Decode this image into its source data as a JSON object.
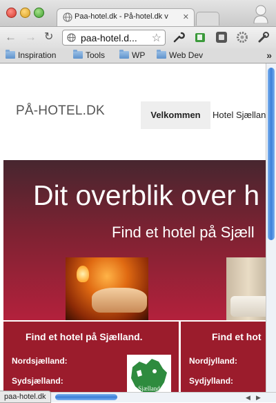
{
  "browser": {
    "tab_title": "Paa-hotel.dk - På-hotel.dk v",
    "tab_close": "✕",
    "url": "paa-hotel.d...",
    "bookmarks": [
      "Inspiration",
      "Tools",
      "WP",
      "Web Dev"
    ],
    "bookmarks_more": "»",
    "status_text": "paa-hotel.dk"
  },
  "site": {
    "logo_text": "PÅ-HOTEL.DK",
    "nav": [
      "Velkommen",
      "Hotel Sjælland"
    ]
  },
  "hero": {
    "title": "Dit overblik over h",
    "subtitle": "Find et hotel på Sjæll"
  },
  "boxes": {
    "left": {
      "title": "Find et hotel på Sjælland.",
      "regions": [
        "Nordsjælland:",
        "Sydsjælland:"
      ],
      "map_label": "Sjælland"
    },
    "right": {
      "title": "Find et hot",
      "regions": [
        "Nordjylland:",
        "Sydjylland:"
      ]
    }
  },
  "colors": {
    "hero_top": "#47262f",
    "hero_bottom": "#b3213c",
    "box_red": "#9b1c2c",
    "map_green": "#2e8b3e"
  },
  "scroll": {
    "vertical_position": 0,
    "horizontal_position": 0.2
  }
}
